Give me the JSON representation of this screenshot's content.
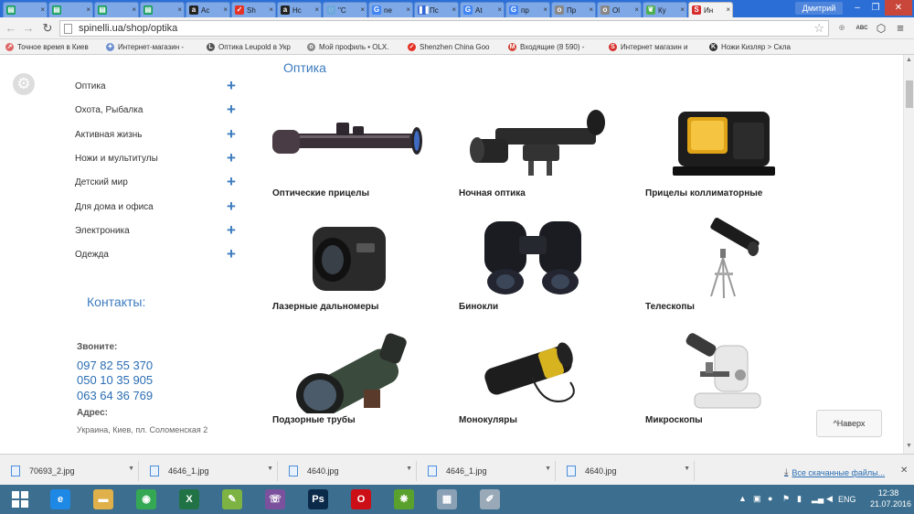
{
  "browser": {
    "tabs": [
      {
        "title": "",
        "icon": "sheets-icon",
        "color": "#0f9d58",
        "glyph": "▤"
      },
      {
        "title": "",
        "icon": "sheets-icon",
        "color": "#0f9d58",
        "glyph": "▤"
      },
      {
        "title": "",
        "icon": "sheets-icon",
        "color": "#0f9d58",
        "glyph": "▤"
      },
      {
        "title": "",
        "icon": "sheets-icon",
        "color": "#0f9d58",
        "glyph": "▤"
      },
      {
        "title": "Ac",
        "icon": "amazon-icon",
        "color": "#222222",
        "glyph": "a"
      },
      {
        "title": "Sh",
        "icon": "aliexpress-icon",
        "color": "#e43225",
        "glyph": "✓"
      },
      {
        "title": "Hc",
        "icon": "amazon-icon",
        "color": "#222222",
        "glyph": "a"
      },
      {
        "title": "\"C",
        "icon": "generic-icon",
        "color": "#6fa8dc",
        "glyph": "◌"
      },
      {
        "title": "ne",
        "icon": "google-icon",
        "color": "#4285f4",
        "glyph": "G"
      },
      {
        "title": "Пс",
        "icon": "pause-icon",
        "color": "#3367d6",
        "glyph": "❚❚"
      },
      {
        "title": "At",
        "icon": "google-icon",
        "color": "#4285f4",
        "glyph": "G"
      },
      {
        "title": "пр",
        "icon": "google-icon",
        "color": "#4285f4",
        "glyph": "G"
      },
      {
        "title": "Пр",
        "icon": "olx-icon",
        "color": "#888888",
        "glyph": "o"
      },
      {
        "title": "Ol",
        "icon": "olx-icon",
        "color": "#888888",
        "glyph": "o"
      },
      {
        "title": "Ку",
        "icon": "leaf-icon",
        "color": "#4caf50",
        "glyph": "❦"
      },
      {
        "title": "Ин",
        "icon": "spinelli-icon",
        "color": "#d62d2d",
        "glyph": "S"
      }
    ],
    "active_tab_index": 15,
    "user_name": "Дмитрий",
    "url": "spinelli.ua/shop/optika",
    "bookmarks": [
      {
        "label": "Точное время в Киев",
        "icon": "clock-icon",
        "color": "#e06666",
        "glyph": "↗"
      },
      {
        "label": "Интернет-магазин -",
        "icon": "spark-icon",
        "color": "#6d8fcf",
        "glyph": "✦"
      },
      {
        "label": "Оптика Leupold в Укр",
        "icon": "leupold-icon",
        "color": "#555555",
        "glyph": "L"
      },
      {
        "label": "Мой профиль • OLX.",
        "icon": "olx-icon",
        "color": "#888888",
        "glyph": "o"
      },
      {
        "label": "Shenzhen China Goo",
        "icon": "aliexpress-icon",
        "color": "#e43225",
        "glyph": "✓"
      },
      {
        "label": "Входящие (8 590) -",
        "icon": "gmail-icon",
        "color": "#d44638",
        "glyph": "M"
      },
      {
        "label": "Интернет магазин и",
        "icon": "spinelli-icon",
        "color": "#d62d2d",
        "glyph": "S"
      },
      {
        "label": "Ножи Кизляр > Скла",
        "icon": "kizlyar-icon",
        "color": "#333333",
        "glyph": "K"
      }
    ]
  },
  "sidebar": {
    "menu": [
      {
        "label": "Оптика"
      },
      {
        "label": "Охота, Рыбалка"
      },
      {
        "label": "Активная жизнь"
      },
      {
        "label": "Ножи и мультитулы"
      },
      {
        "label": "Детский мир"
      },
      {
        "label": "Для дома и офиса"
      },
      {
        "label": "Электроника"
      },
      {
        "label": "Одежда"
      }
    ],
    "expand_symbol": "+",
    "contacts_title": "Контакты:",
    "call_label": "Звоните:",
    "phones": [
      "097 82 55 370",
      "050 10 35 905",
      "063 64 36 769"
    ],
    "address_label": "Адрес:",
    "address": "Украина, Киев, пл. Соломенская 2"
  },
  "main": {
    "section_title": "Оптика",
    "products": [
      {
        "label": "Оптические прицелы",
        "icon": "rifle-scope-icon"
      },
      {
        "label": "Ночная оптика",
        "icon": "night-vision-icon"
      },
      {
        "label": "Прицелы коллиматорные",
        "icon": "red-dot-sight-icon"
      },
      {
        "label": "Лазерные дальномеры",
        "icon": "rangefinder-icon"
      },
      {
        "label": "Бинокли",
        "icon": "binoculars-icon"
      },
      {
        "label": "Телескопы",
        "icon": "telescope-icon"
      },
      {
        "label": "Подзорные трубы",
        "icon": "spotting-scope-icon"
      },
      {
        "label": "Монокуляры",
        "icon": "monocular-icon"
      },
      {
        "label": "Микроскопы",
        "icon": "microscope-icon"
      }
    ],
    "back_to_top": "^Наверх"
  },
  "downloads": {
    "items": [
      "70693_2.jpg",
      "4646_1.jpg",
      "4640.jpg",
      "4646_1.jpg",
      "4640.jpg"
    ],
    "show_all": "Все скачанные файлы..."
  },
  "taskbar": {
    "apps": [
      {
        "icon": "ie-icon",
        "color": "#1e88e5",
        "glyph": "e"
      },
      {
        "icon": "explorer-icon",
        "color": "#e0b04a",
        "glyph": "▬"
      },
      {
        "icon": "chrome-icon",
        "color": "#34a853",
        "glyph": "◉"
      },
      {
        "icon": "excel-icon",
        "color": "#217346",
        "glyph": "X"
      },
      {
        "icon": "notes-icon",
        "color": "#7cb342",
        "glyph": "✎"
      },
      {
        "icon": "viber-icon",
        "color": "#7b519d",
        "glyph": "☏"
      },
      {
        "icon": "photoshop-icon",
        "color": "#0b2a4a",
        "glyph": "Ps"
      },
      {
        "icon": "opera-icon",
        "color": "#cc0f16",
        "glyph": "O"
      },
      {
        "icon": "greenshot-icon",
        "color": "#5aa02c",
        "glyph": "❋"
      },
      {
        "icon": "calculator-icon",
        "color": "#8aa0b5",
        "glyph": "▦"
      },
      {
        "icon": "paint-icon",
        "color": "#9aa9b8",
        "glyph": "✐"
      }
    ],
    "language": "ENG",
    "time": "12:38",
    "date": "21.07.2016"
  }
}
